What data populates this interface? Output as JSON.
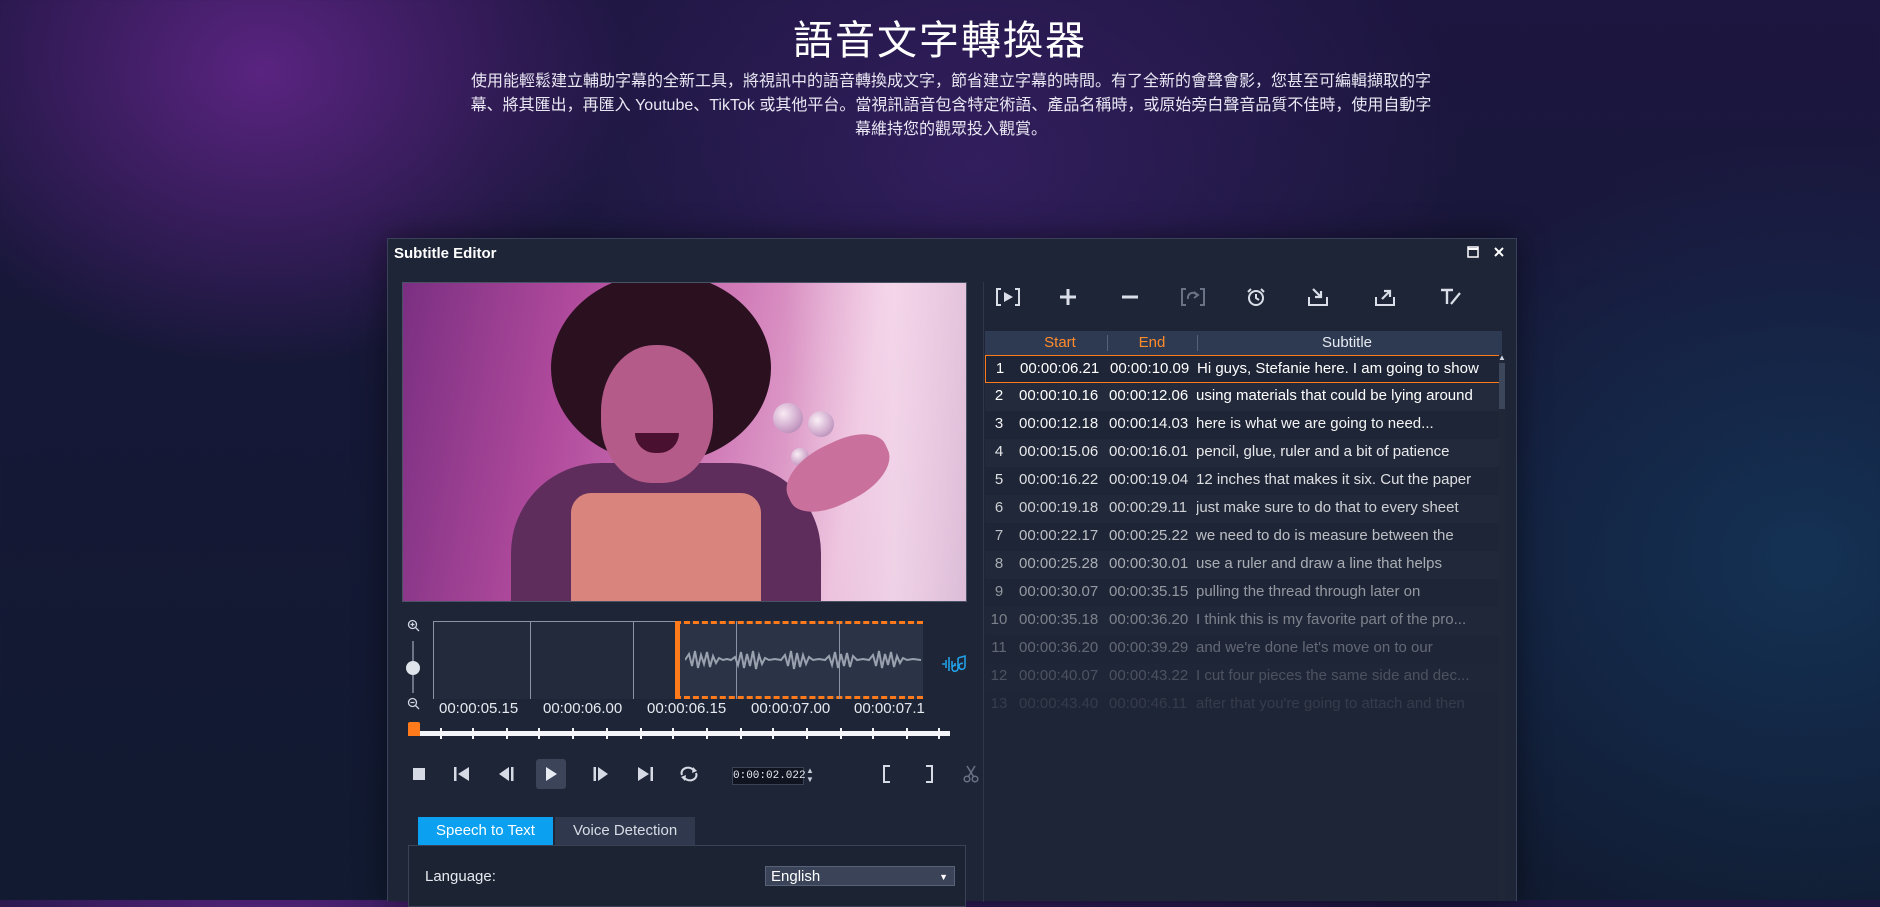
{
  "hero": {
    "title": "語音文字轉換器",
    "description": "使用能輕鬆建立輔助字幕的全新工具，將視訊中的語音轉換成文字，節省建立字幕的時間。有了全新的會聲會影，您甚至可編輯擷取的字幕、將其匯出，再匯入 Youtube、TikTok 或其他平台。當視訊語音包含特定術語、產品名稱時，或原始旁白聲音品質不佳時，使用自動字幕維持您的觀眾投入觀賞。"
  },
  "editor": {
    "title": "Subtitle Editor",
    "timeline": {
      "times": [
        "00:00:05.15",
        "00:00:06.00",
        "00:00:06.15",
        "00:00:07.00",
        "00:00:07.1"
      ]
    },
    "timecode": "0:00:02.022",
    "tabs": [
      "Speech to Text",
      "Voice Detection"
    ],
    "language_label": "Language:",
    "language_value": "English",
    "table": {
      "headers": {
        "start": "Start",
        "end": "End",
        "subtitle": "Subtitle"
      },
      "rows": [
        {
          "n": "1",
          "start": "00:00:06.21",
          "end": "00:00:10.09",
          "text": "Hi guys, Stefanie here. I am going to show"
        },
        {
          "n": "2",
          "start": "00:00:10.16",
          "end": "00:00:12.06",
          "text": "using materials that could be lying around"
        },
        {
          "n": "3",
          "start": "00:00:12.18",
          "end": "00:00:14.03",
          "text": "here is what we are going to need..."
        },
        {
          "n": "4",
          "start": "00:00:15.06",
          "end": "00:00:16.01",
          "text": "pencil, glue, ruler and a bit of patience"
        },
        {
          "n": "5",
          "start": "00:00:16.22",
          "end": "00:00:19.04",
          "text": "12 inches that makes it six. Cut the paper"
        },
        {
          "n": "6",
          "start": "00:00:19.18",
          "end": "00:00:29.11",
          "text": "just make sure to do that to every sheet"
        },
        {
          "n": "7",
          "start": "00:00:22.17",
          "end": "00:00:25.22",
          "text": "we need to do is measure between the"
        },
        {
          "n": "8",
          "start": "00:00:25.28",
          "end": "00:00:30.01",
          "text": "use a ruler and draw a line that helps"
        },
        {
          "n": "9",
          "start": "00:00:30.07",
          "end": "00:00:35.15",
          "text": "pulling the thread through later on"
        },
        {
          "n": "10",
          "start": "00:00:35.18",
          "end": "00:00:36.20",
          "text": "I think this is my favorite part of the pro..."
        },
        {
          "n": "11",
          "start": "00:00:36.20",
          "end": "00:00:39.29",
          "text": "and we're done let's move on to our"
        },
        {
          "n": "12",
          "start": "00:00:40.07",
          "end": "00:00:43.22",
          "text": "I cut four pieces the same side and dec..."
        },
        {
          "n": "13",
          "start": "00:00:43.40",
          "end": "00:00:46.11",
          "text": "after that you're going to attach and then"
        }
      ]
    }
  },
  "colors": {
    "accent_orange": "#ff7a1a",
    "tab_blue": "#0ba0f0",
    "panel": "#1e2536"
  }
}
